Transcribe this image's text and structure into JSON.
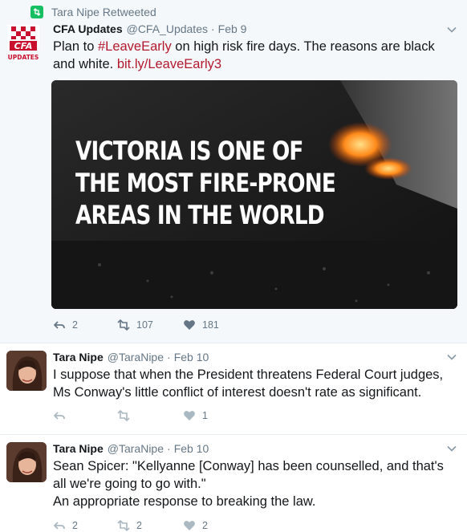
{
  "tweets": [
    {
      "retweet_context": "Tara Nipe Retweeted",
      "name": "CFA Updates",
      "handle": "@CFA_Updates",
      "dot": "·",
      "date": "Feb 9",
      "avatar_text": "CFA",
      "avatar_subtext": "UPDATES",
      "text_parts": [
        "Plan to ",
        "#LeaveEarly",
        " on high risk fire days. The reasons are black and white. ",
        "bit.ly/LeaveEarly3"
      ],
      "media_headline": "VICTORIA IS ONE OF\nTHE MOST FIRE-PRONE\nAREAS IN THE WORLD",
      "reply_count": "2",
      "retweet_count": "107",
      "like_count": "181"
    },
    {
      "name": "Tara Nipe",
      "handle": "@TaraNipe",
      "dot": "·",
      "date": "Feb 10",
      "text": "I suppose that when the President threatens Federal Court judges, Ms Conway's little conflict of interest doesn't rate as significant.",
      "reply_count": "",
      "retweet_count": "",
      "like_count": "1"
    },
    {
      "name": "Tara Nipe",
      "handle": "@TaraNipe",
      "dot": "·",
      "date": "Feb 10",
      "text_line1": "Sean Spicer: \"Kellyanne [Conway] has been counselled, and that's all we're going to go with.\"",
      "text_line2": "An appropriate response to breaking the law.",
      "reply_count": "2",
      "retweet_count": "2",
      "like_count": "2"
    }
  ],
  "colors": {
    "accent": "#b3192e",
    "muted": "#657786",
    "retweet_green": "#17bf63",
    "border": "#e6ecf0"
  },
  "icons": [
    "retweet-context-icon",
    "reply-icon",
    "retweet-icon",
    "like-icon",
    "chevron-down-icon"
  ]
}
